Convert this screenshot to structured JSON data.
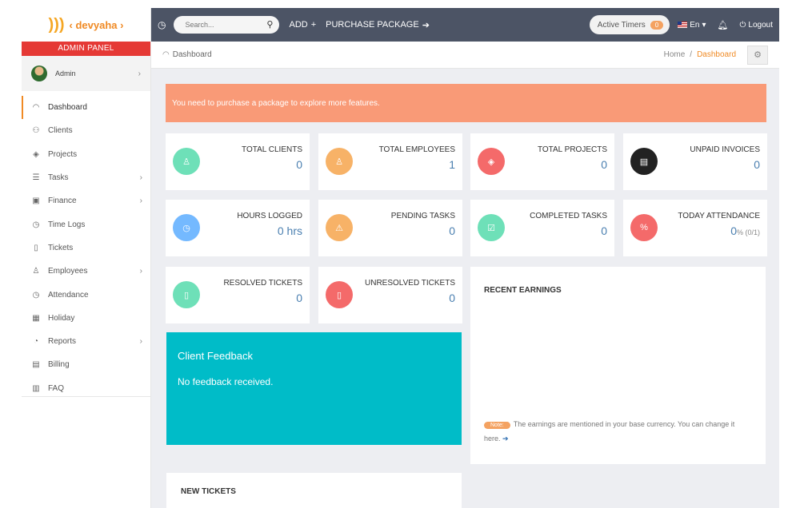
{
  "brand": {
    "name": "devyaha"
  },
  "sidebar": {
    "panel_label": "ADMIN PANEL",
    "user": {
      "name": "Admin"
    },
    "items": [
      {
        "label": "Dashboard",
        "icon": "gauge-icon",
        "active": true,
        "has_sub": false
      },
      {
        "label": "Clients",
        "icon": "users-icon",
        "has_sub": false
      },
      {
        "label": "Projects",
        "icon": "layers-icon",
        "has_sub": false
      },
      {
        "label": "Tasks",
        "icon": "list-icon",
        "has_sub": true
      },
      {
        "label": "Finance",
        "icon": "money-icon",
        "has_sub": true
      },
      {
        "label": "Time Logs",
        "icon": "clock-icon",
        "has_sub": false
      },
      {
        "label": "Tickets",
        "icon": "ticket-icon",
        "has_sub": false
      },
      {
        "label": "Employees",
        "icon": "user-icon",
        "has_sub": true
      },
      {
        "label": "Attendance",
        "icon": "clock-icon",
        "has_sub": false
      },
      {
        "label": "Holiday",
        "icon": "calendar-icon",
        "has_sub": false
      },
      {
        "label": "Reports",
        "icon": "pie-icon",
        "has_sub": true
      },
      {
        "label": "Billing",
        "icon": "receipt-icon",
        "has_sub": false
      },
      {
        "label": "FAQ",
        "icon": "book-icon",
        "has_sub": false
      }
    ]
  },
  "topbar": {
    "search_placeholder": "Search...",
    "add_label": "ADD",
    "purchase_label": "PURCHASE PACKAGE",
    "timers_label": "Active Timers",
    "timers_count": "0",
    "language": "En",
    "logout_label": "Logout"
  },
  "breadcrumb": {
    "page_title": "Dashboard",
    "home": "Home",
    "separator": "/",
    "current": "Dashboard"
  },
  "alert": {
    "text": "You need to purchase a package to explore more features."
  },
  "cards": [
    {
      "label": "TOTAL CLIENTS",
      "value": "0",
      "color": "#6ee0b8",
      "icon": "user-icon"
    },
    {
      "label": "TOTAL EMPLOYEES",
      "value": "1",
      "color": "#f7b267",
      "icon": "user-icon"
    },
    {
      "label": "TOTAL PROJECTS",
      "value": "0",
      "color": "#f46a6a",
      "icon": "layers-icon"
    },
    {
      "label": "UNPAID INVOICES",
      "value": "0",
      "color": "#222222",
      "icon": "invoice-icon"
    },
    {
      "label": "HOURS LOGGED",
      "value": "0 hrs",
      "color": "#74b9ff",
      "icon": "clock-icon"
    },
    {
      "label": "PENDING TASKS",
      "value": "0",
      "color": "#f7b267",
      "icon": "warning-icon"
    },
    {
      "label": "COMPLETED TASKS",
      "value": "0",
      "color": "#6ee0b8",
      "icon": "check-icon"
    },
    {
      "label": "TODAY ATTENDANCE",
      "value": "0",
      "value_suffix": "% (0/1)",
      "color": "#f46a6a",
      "icon": "percent-icon"
    },
    {
      "label": "RESOLVED TICKETS",
      "value": "0",
      "color": "#6ee0b8",
      "icon": "ticket-icon"
    },
    {
      "label": "UNRESOLVED TICKETS",
      "value": "0",
      "color": "#f46a6a",
      "icon": "ticket-icon"
    }
  ],
  "feedback": {
    "title": "Client Feedback",
    "message": "No feedback received."
  },
  "earnings": {
    "title": "RECENT EARNINGS",
    "note_badge": "Note:",
    "note_text": "The earnings are mentioned in your base currency. You can change it here."
  },
  "tickets_panel": {
    "title": "NEW TICKETS"
  }
}
